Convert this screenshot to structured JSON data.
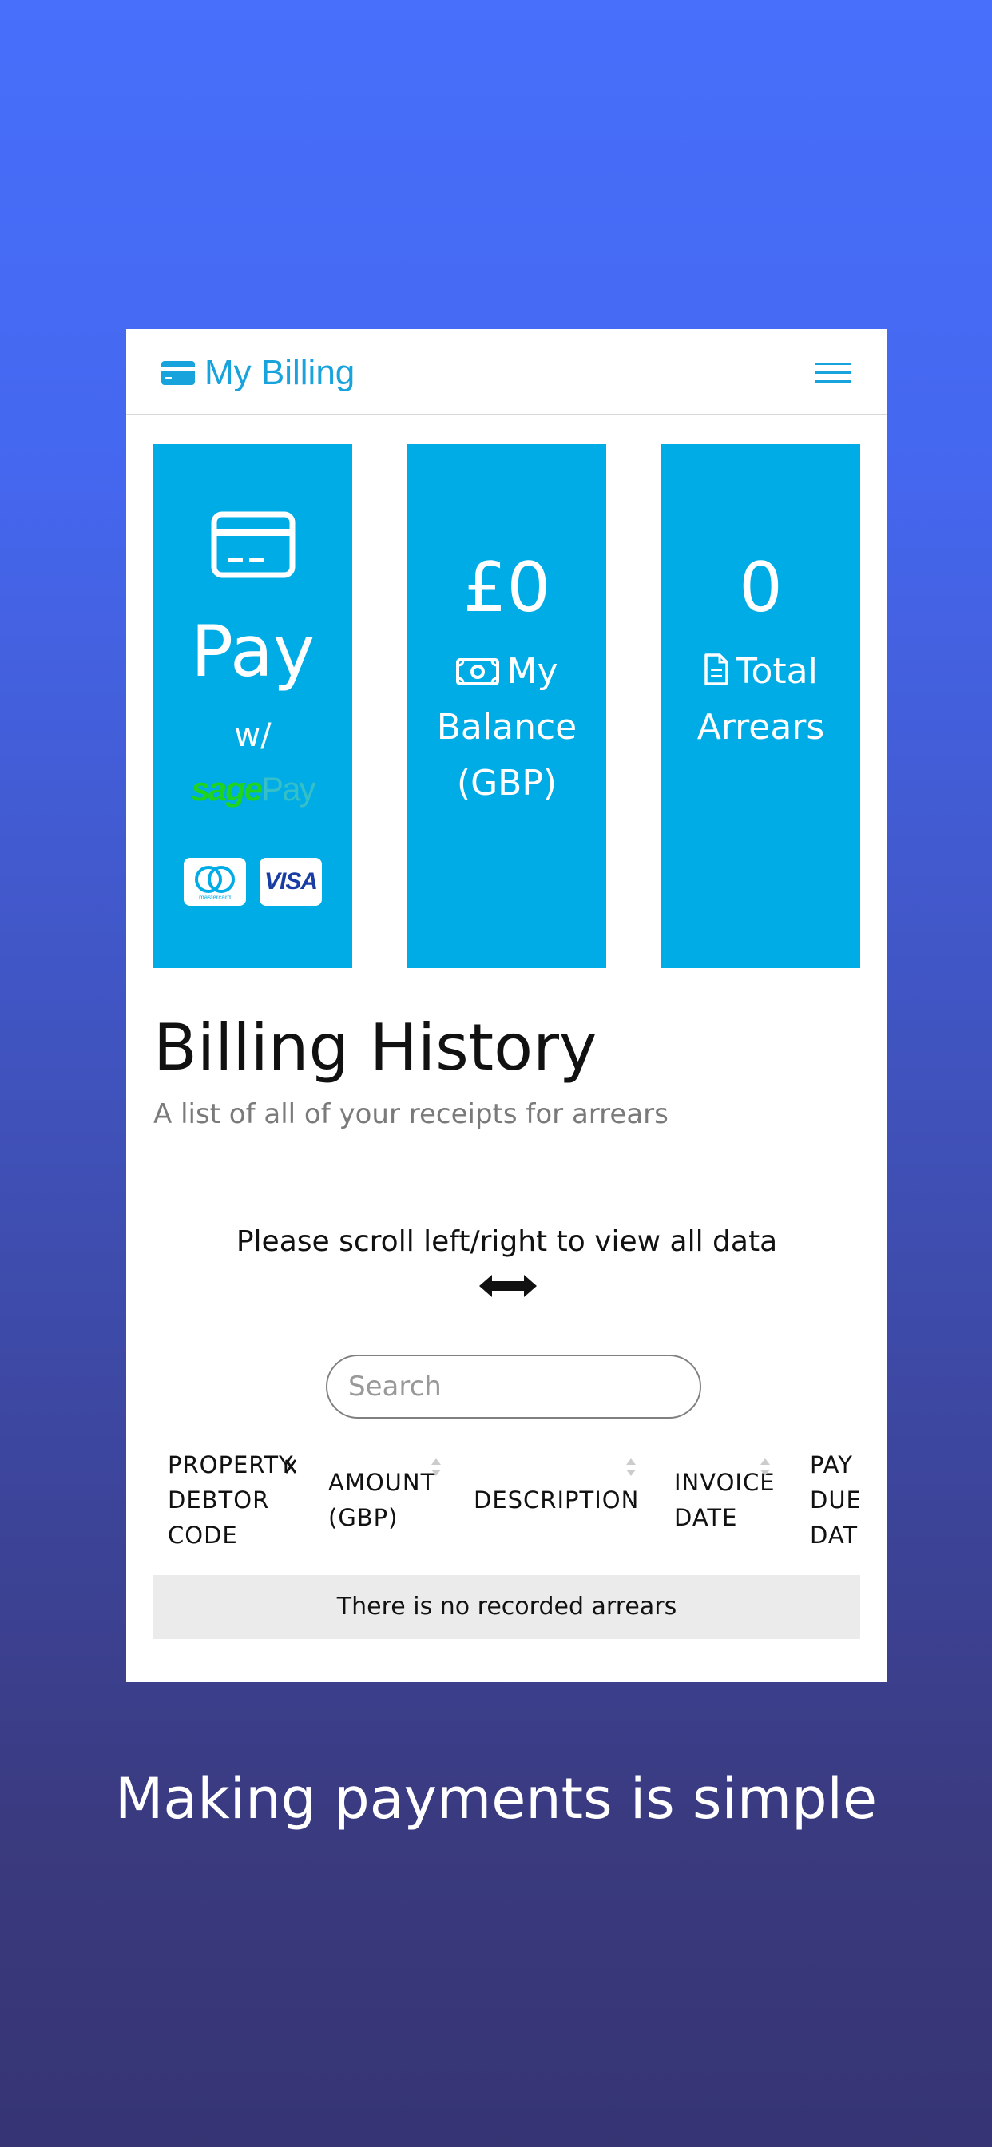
{
  "header": {
    "title": "My Billing",
    "brand_icon": "credit-card-icon",
    "menu_icon": "hamburger-menu-icon"
  },
  "tiles": {
    "pay": {
      "label": "Pay",
      "with": "w/",
      "provider_sage": "sage",
      "provider_pay": "Pay",
      "cards": [
        "mastercard",
        "VISA"
      ]
    },
    "balance": {
      "value": "£0",
      "caption_line1": "My",
      "caption_line2": "Balance",
      "caption_line3": "(GBP)"
    },
    "arrears": {
      "value": "0",
      "caption_line1": "Total",
      "caption_line2": "Arrears"
    }
  },
  "history": {
    "title": "Billing History",
    "subtitle": "A list of all of your receipts for arrears",
    "scroll_hint": "Please scroll left/right to view all data",
    "search_placeholder": "Search",
    "columns": [
      "PROPERTY\nDEBTOR\nCODE",
      "AMOUNT\n(GBP)",
      "DESCRIPTION",
      "INVOICE\nDATE",
      "PAY\nDUE\nDAT"
    ],
    "empty_message": "There is no recorded arrears"
  },
  "tagline": "Making payments is simple",
  "colors": {
    "accent": "#00ace6",
    "brand_text": "#19a3dd",
    "sage_green": "#1ed41e"
  }
}
